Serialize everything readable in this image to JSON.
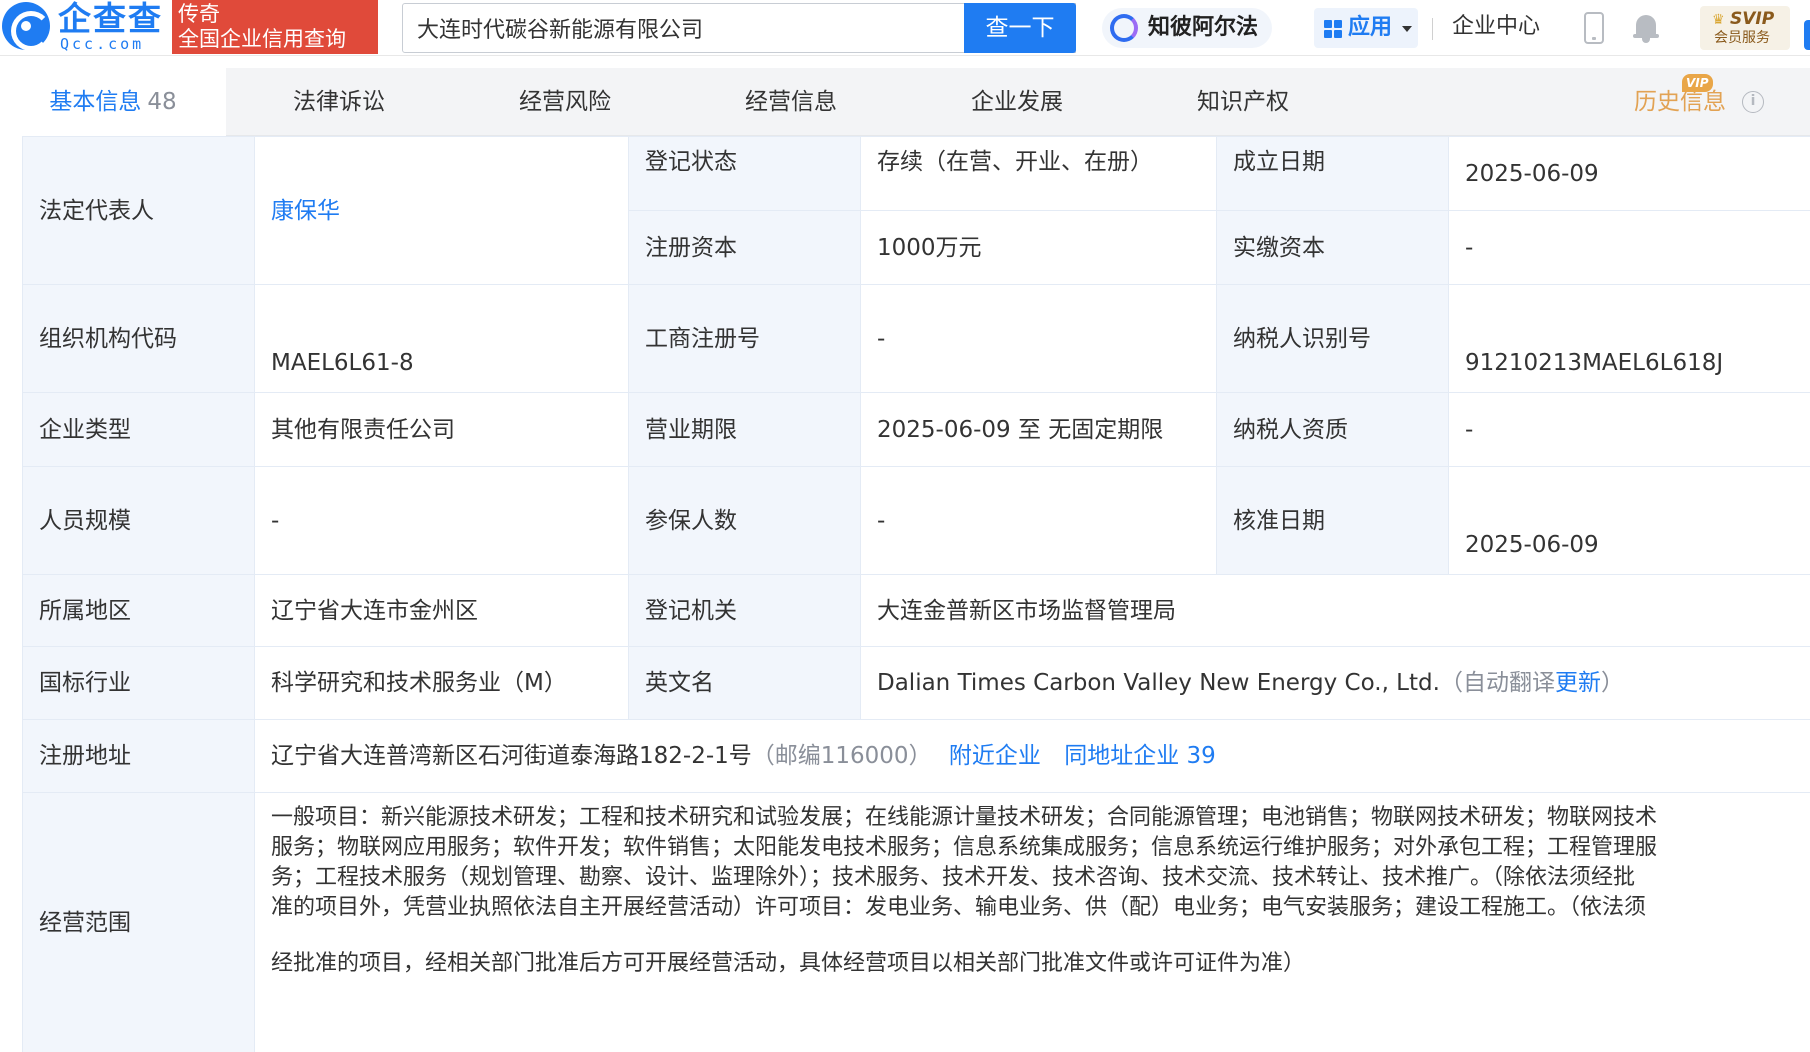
{
  "header": {
    "logo_cn": "企查查",
    "logo_en": "Qcc.com",
    "slogan_line1": "传奇",
    "slogan_line2": "全国企业信用查询",
    "search_value": "大连时代碳谷新能源有限公司",
    "search_button": "查一下",
    "zhibi_label": "知彼阿尔法",
    "apps_label": "应用",
    "enterprise_center": "企业中心",
    "svip_title": "SVIP",
    "svip_sub": "会员服务"
  },
  "tabs": [
    {
      "label": "基本信息",
      "count": "48"
    },
    {
      "label": "法律诉讼"
    },
    {
      "label": "经营风险"
    },
    {
      "label": "经营信息"
    },
    {
      "label": "企业发展"
    },
    {
      "label": "知识产权"
    },
    {
      "label": "历史信息",
      "badge": "VIP"
    }
  ],
  "company": {
    "legal_rep_label": "法定代表人",
    "legal_rep": "康保华",
    "reg_status_label": "登记状态",
    "reg_status": "存续（在营、开业、在册）",
    "founded_label": "成立日期",
    "founded": "2025-06-09",
    "reg_capital_label": "注册资本",
    "reg_capital": "1000万元",
    "paid_capital_label": "实缴资本",
    "paid_capital": "-",
    "org_code_label": "组织机构代码",
    "org_code": "MAEL6L61-8",
    "biz_reg_no_label": "工商注册号",
    "biz_reg_no": "-",
    "taxpayer_id_label": "纳税人识别号",
    "taxpayer_id": "91210213MAEL6L618J",
    "company_type_label": "企业类型",
    "company_type": "其他有限责任公司",
    "biz_term_label": "营业期限",
    "biz_term": "2025-06-09 至 无固定期限",
    "taxpayer_qual_label": "纳税人资质",
    "taxpayer_qual": "-",
    "staff_size_label": "人员规模",
    "staff_size": "-",
    "insured_label": "参保人数",
    "insured": "-",
    "approval_date_label": "核准日期",
    "approval_date": "2025-06-09",
    "region_label": "所属地区",
    "region": "辽宁省大连市金州区",
    "reg_authority_label": "登记机关",
    "reg_authority": "大连金普新区市场监督管理局",
    "industry_label": "国标行业",
    "industry": "科学研究和技术服务业（M）",
    "english_name_label": "英文名",
    "english_name": "Dalian Times Carbon Valley New Energy Co., Ltd.",
    "auto_translate_prefix": "（自动翻译",
    "update_link": "更新",
    "auto_translate_suffix": "）",
    "address_label": "注册地址",
    "address": "辽宁省大连普湾新区石河街道泰海路182-2-1号",
    "postcode": "（邮编116000）",
    "nearby_link": "附近企业",
    "same_address_link": "同地址企业 39",
    "scope_label": "经营范围",
    "scope_lines": [
      "一般项目：新兴能源技术研发；工程和技术研究和试验发展；在线能源计量技术研发；合同能源管理；电池销售；物联网技术研发；物联网技术",
      "服务；物联网应用服务；软件开发；软件销售；太阳能发电技术服务；信息系统集成服务；信息系统运行维护服务；对外承包工程；工程管理服",
      "务；工程技术服务（规划管理、勘察、设计、监理除外）；技术服务、技术开发、技术咨询、技术交流、技术转让、技术推广。（除依法须经批",
      "准的项目外，凭营业执照依法自主开展经营活动）许可项目：发电业务、输电业务、供（配）电业务；电气安装服务；建设工程施工。（依法须",
      "经批准的项目，经相关部门批准后方可开展经营活动，具体经营项目以相关部门批准文件或许可证件为准）"
    ]
  },
  "colors": {
    "brand": "#1f7cf2",
    "slogan_bg": "#e04a3a",
    "label_bg": "#f2f6fc",
    "history_tab": "#e2a253"
  },
  "icons": [
    "logo-icon",
    "clear-icon",
    "zhibi-icon",
    "apps-grid-icon",
    "caret-down-icon",
    "phone-icon",
    "bell-icon",
    "crown-icon",
    "info-icon"
  ]
}
